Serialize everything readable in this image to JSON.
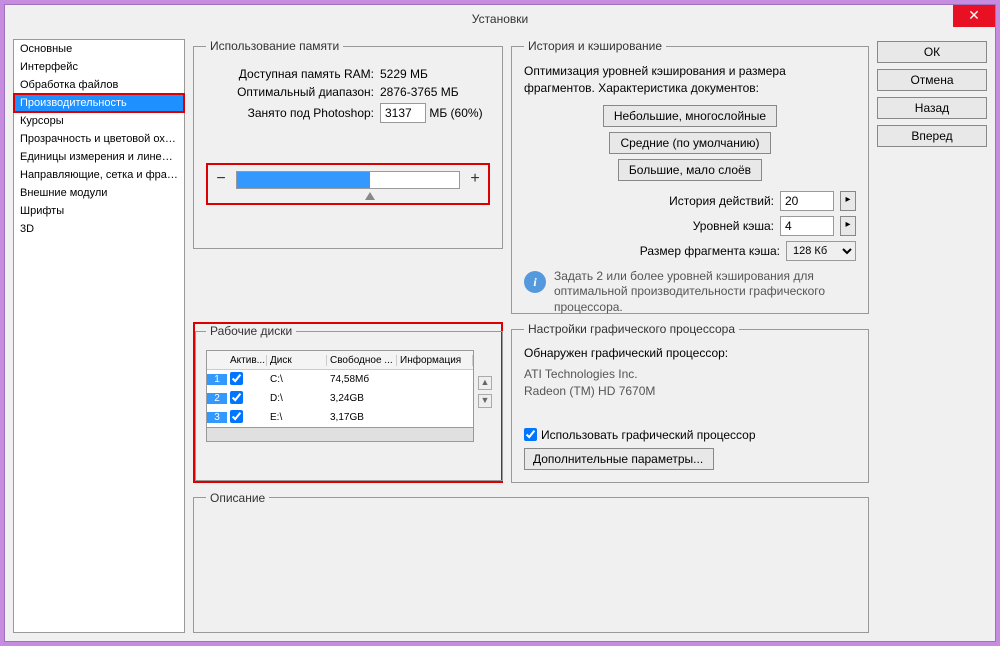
{
  "window": {
    "title": "Установки"
  },
  "sidebar": {
    "items": [
      "Основные",
      "Интерфейс",
      "Обработка файлов",
      "Производительность",
      "Курсоры",
      "Прозрачность и цветовой охват",
      "Единицы измерения и линейки",
      "Направляющие, сетка и фрагменты",
      "Внешние модули",
      "Шрифты",
      "3D"
    ],
    "selected_index": 3
  },
  "memory": {
    "legend": "Использование памяти",
    "available_label": "Доступная память RAM:",
    "available_value": "5229 МБ",
    "range_label": "Оптимальный диапазон:",
    "range_value": "2876-3765 МБ",
    "used_label": "Занято под Photoshop:",
    "used_value": "3137",
    "used_suffix": "МБ (60%)",
    "slider_percent": 60
  },
  "history": {
    "legend": "История и кэширование",
    "desc": "Оптимизация уровней кэширования и размера фрагментов. Характеристика документов:",
    "btn_small": "Небольшие, многослойные",
    "btn_default": "Средние (по умолчанию)",
    "btn_big": "Большие, мало слоёв",
    "history_label": "История действий:",
    "history_value": "20",
    "cache_label": "Уровней кэша:",
    "cache_value": "4",
    "fragment_label": "Размер фрагмента кэша:",
    "fragment_value": "128 Кб",
    "info": "Задать 2 или более уровней кэширования для оптимальной производительности графического процессора."
  },
  "disks": {
    "legend": "Рабочие диски",
    "cols": {
      "active": "Актив...",
      "disk": "Диск",
      "free": "Свободное ...",
      "info": "Информация"
    },
    "rows": [
      {
        "n": "1",
        "active": true,
        "disk": "C:\\",
        "free": "74,58Мб"
      },
      {
        "n": "2",
        "active": true,
        "disk": "D:\\",
        "free": "3,24GB"
      },
      {
        "n": "3",
        "active": true,
        "disk": "E:\\",
        "free": "3,17GB"
      }
    ]
  },
  "gpu": {
    "legend": "Настройки графического процессора",
    "detected_label": "Обнаружен графический процессор:",
    "vendor": "ATI Technologies Inc.",
    "model": "Radeon (TM) HD 7670M",
    "use_gpu_label": "Использовать графический процессор",
    "advanced_btn": "Дополнительные параметры..."
  },
  "description": {
    "legend": "Описание"
  },
  "buttons": {
    "ok": "ОК",
    "cancel": "Отмена",
    "back": "Назад",
    "forward": "Вперед"
  }
}
